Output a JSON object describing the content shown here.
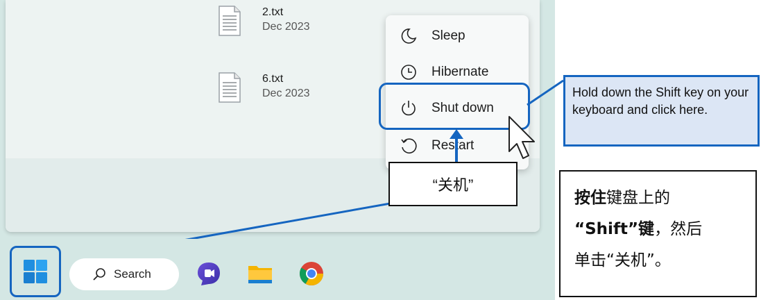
{
  "files": [
    {
      "name": "2.txt",
      "date": "Dec 2023",
      "icon": "text-file-icon"
    },
    {
      "name": "6.txt",
      "date": "Dec 2023",
      "icon": "text-file-icon"
    }
  ],
  "power_menu": {
    "items": [
      {
        "label": "Sleep",
        "icon": "moon-icon"
      },
      {
        "label": "Hibernate",
        "icon": "clock-icon"
      },
      {
        "label": "Shut down",
        "icon": "power-icon"
      },
      {
        "label": "Restart",
        "icon": "restart-icon"
      }
    ]
  },
  "callouts": {
    "english": "Hold down the Shift key on your keyboard and click here.",
    "shutdown_label": "“关机”",
    "chinese": {
      "line1_bold": "按住",
      "line1_rest": "键盘上的",
      "line2_bold": "“Shift”键",
      "line2_rest": "，然后",
      "line3": "单击“关机”。"
    }
  },
  "taskbar": {
    "search_label": "Search",
    "apps": [
      "copilot-icon",
      "file-explorer-icon",
      "chrome-icon"
    ]
  },
  "colors": {
    "accent": "#1565c0",
    "callout_fill": "#dce6f5",
    "desktop": "#d4e7e4"
  }
}
